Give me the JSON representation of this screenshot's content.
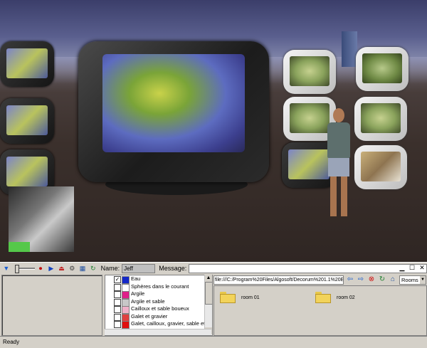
{
  "toolbar": {
    "name_label": "Name:",
    "name_value": "Jeff",
    "message_label": "Message:",
    "message_value": ""
  },
  "surfaces": {
    "list": [
      {
        "label": "Eau",
        "checked": true,
        "color": "#1428c8"
      },
      {
        "label": "Sphères dans le courant",
        "checked": false,
        "color": "#ffffff"
      },
      {
        "label": "Argile",
        "checked": false,
        "color": "#e0208a"
      },
      {
        "label": "Argile et sable",
        "checked": false,
        "color": "#c8c8c8"
      },
      {
        "label": "Cailloux et sable boueux",
        "checked": false,
        "color": "#f0b0c8"
      },
      {
        "label": "Galet et gravier",
        "checked": false,
        "color": "#e04040"
      },
      {
        "label": "Galet, cailloux, gravier, sable et bou",
        "checked": false,
        "color": "#e01010"
      }
    ]
  },
  "browser": {
    "url": "file:///C:/Program%20Files/Algosoft/Decorum%201.1%20En",
    "view_select": "Rooms",
    "folders": [
      {
        "label": "room 01"
      },
      {
        "label": "room 02"
      }
    ]
  },
  "status": {
    "text": "Ready"
  }
}
